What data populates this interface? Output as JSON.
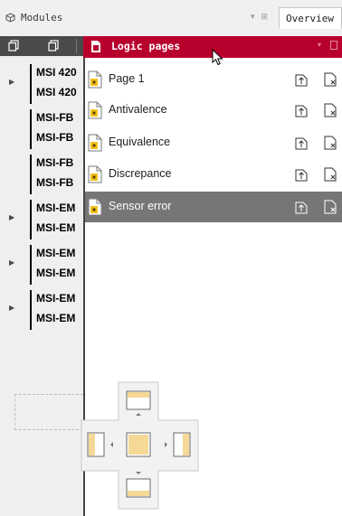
{
  "header": {
    "modules_label": "Modules",
    "right_controls": "▾ ⊞",
    "overview_tab": "Overview"
  },
  "modules": {
    "toolbar_icons": [
      "copy-icon",
      "paste-icon"
    ],
    "groups": [
      {
        "expandable": true,
        "names": [
          "MSI 420",
          "MSI 420"
        ]
      },
      {
        "expandable": false,
        "names": [
          "MSI-FB",
          "MSI-FB"
        ]
      },
      {
        "expandable": false,
        "names": [
          "MSI-FB",
          "MSI-FB"
        ]
      },
      {
        "expandable": true,
        "names": [
          "MSI-EM",
          "MSI-EM"
        ]
      },
      {
        "expandable": true,
        "names": [
          "MSI-EM",
          "MSI-EM"
        ]
      },
      {
        "expandable": true,
        "names": [
          "MSI-EM",
          "MSI-EM"
        ]
      }
    ]
  },
  "logic_pages": {
    "title": "Logic pages",
    "header_controls": "▾",
    "pages": [
      {
        "label": "Page 1",
        "selected": false
      },
      {
        "label": "Antivalence",
        "selected": false
      },
      {
        "label": "Equivalence",
        "selected": false
      },
      {
        "label": "Discrepance",
        "selected": false
      },
      {
        "label": "Sensor error",
        "selected": true
      }
    ]
  },
  "colors": {
    "accent": "#b8002d",
    "selected_row": "#767676",
    "toolbar_dark": "#4a4a4a",
    "dock_fill": "#f5d896"
  }
}
